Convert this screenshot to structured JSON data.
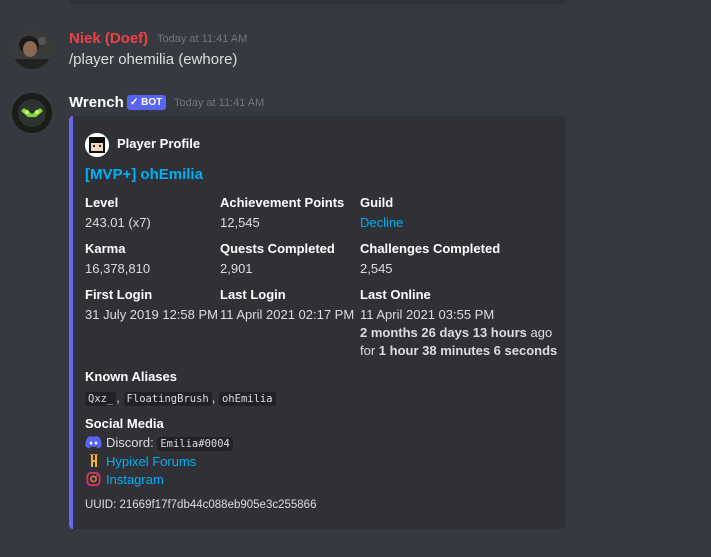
{
  "messages": [
    {
      "username": "Niek (Doef)",
      "username_color": "#ed4245",
      "timestamp": "Today at 11:41 AM",
      "content": "/player ohemilia (ewhore)"
    },
    {
      "username": "Wrench",
      "username_color": "#ffffff",
      "bot_tag": "BOT",
      "timestamp": "Today at 11:41 AM"
    }
  ],
  "embed": {
    "accent": "#6666ee",
    "author": "Player Profile",
    "title": "[MVP+] ohEmilia",
    "fields": {
      "level": {
        "name": "Level",
        "value": "243.01 (x7)"
      },
      "achievement_points": {
        "name": "Achievement Points",
        "value": "12,545"
      },
      "guild": {
        "name": "Guild",
        "value": "Decline"
      },
      "karma": {
        "name": "Karma",
        "value": "16,378,810"
      },
      "quests": {
        "name": "Quests Completed",
        "value": "2,901"
      },
      "challenges": {
        "name": "Challenges Completed",
        "value": "2,545"
      },
      "first_login": {
        "name": "First Login",
        "value": "31 July 2019 12:58 PM"
      },
      "last_login": {
        "name": "Last Login",
        "value": "11 April 2021 02:17 PM"
      },
      "last_online": {
        "name": "Last Online",
        "value": "11 April 2021 03:55 PM",
        "ago_bold": "2 months 26 days 13 hours",
        "ago_suffix": " ago",
        "for_prefix": "for ",
        "for_bold": "1 hour 38 minutes 6 seconds"
      },
      "aliases": {
        "name": "Known Aliases",
        "values": [
          "Qxz_",
          "FloatingBrush",
          "ohEmilia"
        ],
        "separator": ","
      },
      "social": {
        "name": "Social Media",
        "discord_label": "Discord:",
        "discord_tag": "Emilia#0004",
        "forums": "Hypixel Forums",
        "instagram": "Instagram"
      }
    },
    "footer": "UUID: 21669f17f7db44c088eb905e3c255866"
  }
}
